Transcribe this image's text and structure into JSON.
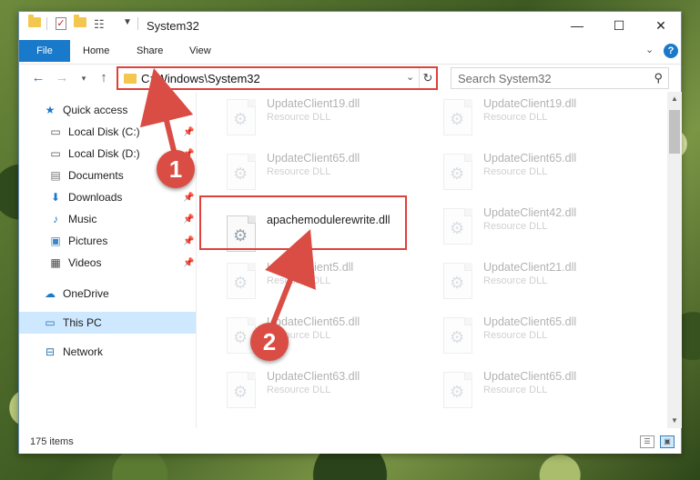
{
  "window": {
    "title": "System32"
  },
  "ribbon": {
    "tabs": [
      "File",
      "Home",
      "Share",
      "View"
    ]
  },
  "address": {
    "path": "C:\\Windows\\System32"
  },
  "search": {
    "placeholder": "Search System32"
  },
  "nav": {
    "quick_access": "Quick access",
    "items": [
      {
        "label": "Local Disk (C:)",
        "icon": "drive-icon",
        "pinned": true
      },
      {
        "label": "Local Disk (D:)",
        "icon": "drive-icon",
        "pinned": true
      },
      {
        "label": "Documents",
        "icon": "documents-icon",
        "pinned": true
      },
      {
        "label": "Downloads",
        "icon": "downloads-icon",
        "pinned": true
      },
      {
        "label": "Music",
        "icon": "music-icon",
        "pinned": true
      },
      {
        "label": "Pictures",
        "icon": "pictures-icon",
        "pinned": true
      },
      {
        "label": "Videos",
        "icon": "videos-icon",
        "pinned": true
      }
    ],
    "onedrive": "OneDrive",
    "this_pc": "This PC",
    "network": "Network"
  },
  "files": {
    "left": [
      {
        "name": "UpdateClient19.dll",
        "type": "Resource DLL"
      },
      {
        "name": "UpdateClient65.dll",
        "type": "Resource DLL"
      },
      {
        "name": "apachemodulerewrite.dll",
        "type": ""
      },
      {
        "name": "UpdateClient5.dll",
        "type": "Resource DLL"
      },
      {
        "name": "UpdateClient65.dll",
        "type": "Resource DLL"
      },
      {
        "name": "UpdateClient63.dll",
        "type": "Resource DLL"
      }
    ],
    "right": [
      {
        "name": "UpdateClient19.dll",
        "type": "Resource DLL"
      },
      {
        "name": "UpdateClient65.dll",
        "type": "Resource DLL"
      },
      {
        "name": "UpdateClient42.dll",
        "type": "Resource DLL"
      },
      {
        "name": "UpdateClient21.dll",
        "type": "Resource DLL"
      },
      {
        "name": "UpdateClient65.dll",
        "type": "Resource DLL"
      },
      {
        "name": "UpdateClient65.dll",
        "type": "Resource DLL"
      }
    ]
  },
  "status": {
    "item_count": "175 items"
  },
  "annotations": {
    "step1": "1",
    "step2": "2"
  },
  "colors": {
    "accent": "#1979ca",
    "highlight": "#e0403a",
    "badge": "#d94d44"
  }
}
